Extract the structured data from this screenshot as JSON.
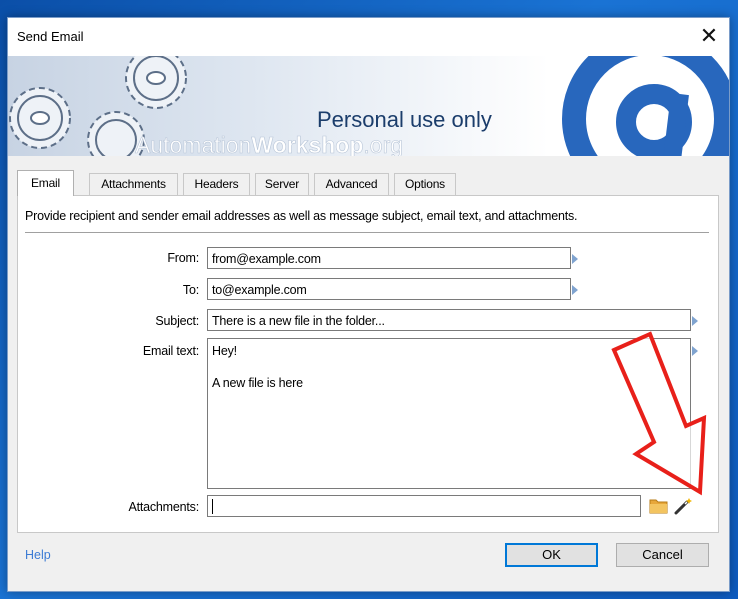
{
  "window": {
    "title": "Send Email",
    "close_glyph": "✕"
  },
  "banner": {
    "watermark": "Personal use only",
    "brand_part1": "Automation",
    "brand_part2": "Workshop",
    "brand_part3": ".org",
    "logo_icon": "at-sign-icon",
    "gear_icon": "gear-icon"
  },
  "tabs": [
    {
      "label": "Email",
      "active": true
    },
    {
      "label": "Attachments",
      "active": false
    },
    {
      "label": "Headers",
      "active": false
    },
    {
      "label": "Server",
      "active": false
    },
    {
      "label": "Advanced",
      "active": false
    },
    {
      "label": "Options",
      "active": false
    }
  ],
  "description": "Provide recipient and sender email addresses as well as message subject, email text, and attachments.",
  "form": {
    "from_label": "From:",
    "from_value": "from@example.com",
    "to_label": "To:",
    "to_value": "to@example.com",
    "subject_label": "Subject:",
    "subject_value": "There is a new file in the folder...",
    "email_text_label": "Email text:",
    "email_text_line1": "Hey!",
    "email_text_line2": "A new file is here",
    "attachments_label": "Attachments:",
    "attachments_value": "",
    "browse_icon": "folder-icon",
    "wizard_icon": "magic-wand-icon"
  },
  "annotation": {
    "arrow_icon": "red-arrow-icon",
    "color": "#e8201a"
  },
  "footer": {
    "help_label": "Help",
    "ok_label": "OK",
    "cancel_label": "Cancel"
  },
  "colors": {
    "accent": "#0078d7",
    "link": "#3c7bd4",
    "desktop": "#1a73d4"
  }
}
